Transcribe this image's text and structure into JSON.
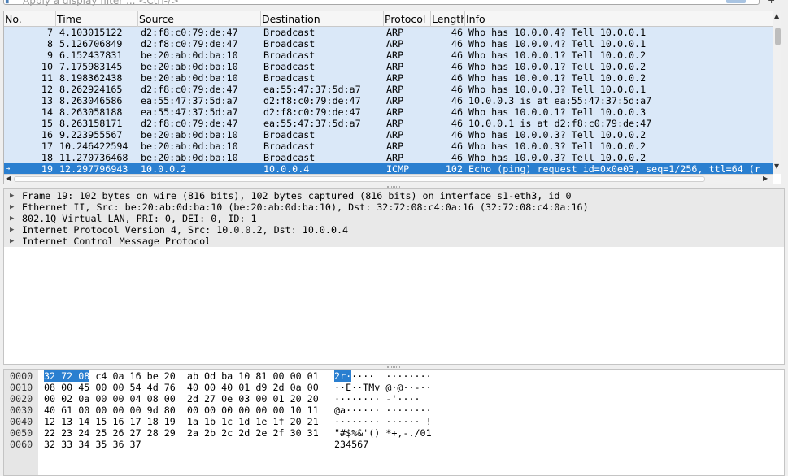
{
  "filter": {
    "placeholder": "Apply a display filter ... <Ctrl-/>",
    "expression_label": "+"
  },
  "packet_list": {
    "columns": [
      {
        "key": "no",
        "label": "No."
      },
      {
        "key": "time",
        "label": "Time"
      },
      {
        "key": "source",
        "label": "Source"
      },
      {
        "key": "destination",
        "label": "Destination"
      },
      {
        "key": "protocol",
        "label": "Protocol"
      },
      {
        "key": "length",
        "label": "Length"
      },
      {
        "key": "info",
        "label": "Info"
      }
    ],
    "rows": [
      {
        "no": "7",
        "time": "4.103015122",
        "source": "d2:f8:c0:79:de:47",
        "destination": "Broadcast",
        "protocol": "ARP",
        "length": "46",
        "info": "Who has 10.0.0.4? Tell 10.0.0.1"
      },
      {
        "no": "8",
        "time": "5.126706849",
        "source": "d2:f8:c0:79:de:47",
        "destination": "Broadcast",
        "protocol": "ARP",
        "length": "46",
        "info": "Who has 10.0.0.4? Tell 10.0.0.1"
      },
      {
        "no": "9",
        "time": "6.152437831",
        "source": "be:20:ab:0d:ba:10",
        "destination": "Broadcast",
        "protocol": "ARP",
        "length": "46",
        "info": "Who has 10.0.0.1? Tell 10.0.0.2"
      },
      {
        "no": "10",
        "time": "7.175983145",
        "source": "be:20:ab:0d:ba:10",
        "destination": "Broadcast",
        "protocol": "ARP",
        "length": "46",
        "info": "Who has 10.0.0.1? Tell 10.0.0.2"
      },
      {
        "no": "11",
        "time": "8.198362438",
        "source": "be:20:ab:0d:ba:10",
        "destination": "Broadcast",
        "protocol": "ARP",
        "length": "46",
        "info": "Who has 10.0.0.1? Tell 10.0.0.2"
      },
      {
        "no": "12",
        "time": "8.262924165",
        "source": "d2:f8:c0:79:de:47",
        "destination": "ea:55:47:37:5d:a7",
        "protocol": "ARP",
        "length": "46",
        "info": "Who has 10.0.0.3? Tell 10.0.0.1"
      },
      {
        "no": "13",
        "time": "8.263046586",
        "source": "ea:55:47:37:5d:a7",
        "destination": "d2:f8:c0:79:de:47",
        "protocol": "ARP",
        "length": "46",
        "info": "10.0.0.3 is at ea:55:47:37:5d:a7"
      },
      {
        "no": "14",
        "time": "8.263058188",
        "source": "ea:55:47:37:5d:a7",
        "destination": "d2:f8:c0:79:de:47",
        "protocol": "ARP",
        "length": "46",
        "info": "Who has 10.0.0.1? Tell 10.0.0.3"
      },
      {
        "no": "15",
        "time": "8.263158171",
        "source": "d2:f8:c0:79:de:47",
        "destination": "ea:55:47:37:5d:a7",
        "protocol": "ARP",
        "length": "46",
        "info": "10.0.0.1 is at d2:f8:c0:79:de:47"
      },
      {
        "no": "16",
        "time": "9.223955567",
        "source": "be:20:ab:0d:ba:10",
        "destination": "Broadcast",
        "protocol": "ARP",
        "length": "46",
        "info": "Who has 10.0.0.3? Tell 10.0.0.2"
      },
      {
        "no": "17",
        "time": "10.246422594",
        "source": "be:20:ab:0d:ba:10",
        "destination": "Broadcast",
        "protocol": "ARP",
        "length": "46",
        "info": "Who has 10.0.0.3? Tell 10.0.0.2"
      },
      {
        "no": "18",
        "time": "11.270736468",
        "source": "be:20:ab:0d:ba:10",
        "destination": "Broadcast",
        "protocol": "ARP",
        "length": "46",
        "info": "Who has 10.0.0.3? Tell 10.0.0.2"
      },
      {
        "no": "19",
        "time": "12.297796943",
        "source": "10.0.0.2",
        "destination": "10.0.0.4",
        "protocol": "ICMP",
        "length": "102",
        "info": "Echo (ping) request  id=0x0e03, seq=1/256, ttl=64 (r"
      }
    ],
    "selected_marker": "→",
    "row_color": "#dae8f8",
    "selected_color": "#2a7fd0"
  },
  "details": {
    "lines": [
      "Frame 19: 102 bytes on wire (816 bits), 102 bytes captured (816 bits) on interface s1-eth3, id 0",
      "Ethernet II, Src: be:20:ab:0d:ba:10 (be:20:ab:0d:ba:10), Dst: 32:72:08:c4:0a:16 (32:72:08:c4:0a:16)",
      "802.1Q Virtual LAN, PRI: 0, DEI: 0, ID: 1",
      "Internet Protocol Version 4, Src: 10.0.0.2, Dst: 10.0.0.4",
      "Internet Control Message Protocol"
    ]
  },
  "bytes": {
    "rows": [
      {
        "offset": "0000",
        "hex_hl": "32 72 08",
        "hex": " c4 0a 16 be 20  ab 0d ba 10 81 00 00 01",
        "ascii_hl": "2r·",
        "ascii": "····  ········"
      },
      {
        "offset": "0010",
        "hex_hl": "",
        "hex": "08 00 45 00 00 54 4d 76  40 00 40 01 d9 2d 0a 00",
        "ascii_hl": "",
        "ascii": "··E··TMv @·@··-··"
      },
      {
        "offset": "0020",
        "hex_hl": "",
        "hex": "00 02 0a 00 00 04 08 00  2d 27 0e 03 00 01 20 20",
        "ascii_hl": "",
        "ascii": "········ -'····  "
      },
      {
        "offset": "0030",
        "hex_hl": "",
        "hex": "40 61 00 00 00 00 9d 80  00 00 00 00 00 00 10 11",
        "ascii_hl": "",
        "ascii": "@a······ ········"
      },
      {
        "offset": "0040",
        "hex_hl": "",
        "hex": "12 13 14 15 16 17 18 19  1a 1b 1c 1d 1e 1f 20 21",
        "ascii_hl": "",
        "ascii": "········ ······ !"
      },
      {
        "offset": "0050",
        "hex_hl": "",
        "hex": "22 23 24 25 26 27 28 29  2a 2b 2c 2d 2e 2f 30 31",
        "ascii_hl": "",
        "ascii": "\"#$%&'() *+,-./01"
      },
      {
        "offset": "0060",
        "hex_hl": "",
        "hex": "32 33 34 35 36 37",
        "ascii_hl": "",
        "ascii": "234567"
      }
    ]
  }
}
